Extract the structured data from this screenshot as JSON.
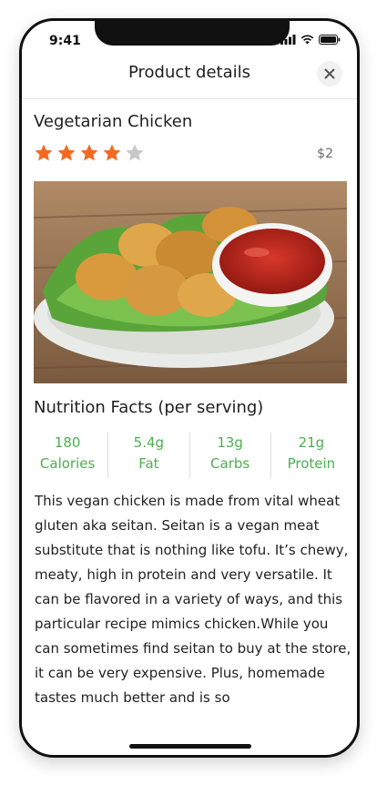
{
  "status_bar": {
    "time": "9:41"
  },
  "header": {
    "title": "Product details"
  },
  "product": {
    "name": "Vegetarian Chicken",
    "rating": {
      "value": 4,
      "max": 5
    },
    "price": "$2"
  },
  "nutrition": {
    "title": "Nutrition Facts (per serving)",
    "items": [
      {
        "value": "180",
        "label": "Calories"
      },
      {
        "value": "5.4g",
        "label": "Fat"
      },
      {
        "value": "13g",
        "label": "Carbs"
      },
      {
        "value": "21g",
        "label": "Protein"
      }
    ]
  },
  "description": "This vegan chicken is made from vital wheat gluten aka seitan. Seitan is a vegan meat substitute that is nothing like tofu. It’s chewy, meaty, high in protein and very versatile. It can be flavored in a variety of ways, and this particular recipe mimics chicken.While you can sometimes find seitan to buy at the store, it can be very expensive. Plus, homemade tastes much better and is so",
  "colors": {
    "star_filled": "#f26b21",
    "star_empty": "#c8c8c8",
    "accent_green": "#4caf50"
  },
  "icons": {
    "close": "close-icon",
    "signal": "signal-icon",
    "wifi": "wifi-icon",
    "battery": "battery-icon"
  }
}
